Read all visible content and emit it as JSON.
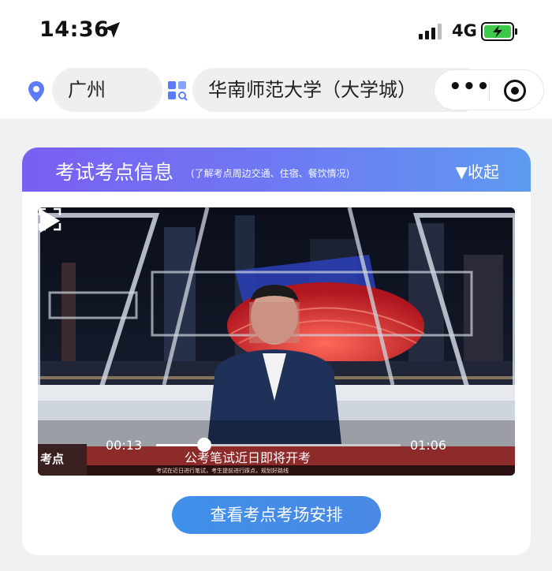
{
  "status_bar": {
    "time": "14:36",
    "network": "4G",
    "icons": [
      "location-arrow-icon",
      "signal-icon",
      "battery-charging-icon"
    ],
    "battery_color": "#3fc94a"
  },
  "nav": {
    "city": "广州",
    "campus": "华南师范大学（大学城）",
    "more_label": "•••",
    "icons": [
      "location-pin-icon",
      "campus-grid-icon",
      "close-target-icon"
    ],
    "pin_color": "#5b7cf6"
  },
  "card": {
    "title": "考试考点信息",
    "subtitle": "(了解考点周边交通、住宿、餐饮情况)",
    "collapse_label": "▼收起",
    "header_gradient": [
      "#7a5ff2",
      "#5e9af0"
    ],
    "video": {
      "current_time": "00:13",
      "duration": "01:06",
      "progress": 0.197,
      "news_tag": "考点",
      "ticker_title": "公考笔试近日即将开考",
      "ticker_subtitle": "考试在近日进行笔试，考生提前进行踩点，规划好路线",
      "icons": [
        "play-icon",
        "fullscreen-icon"
      ]
    },
    "action_button": "查看考点考场安排",
    "accent_color": "#418de9"
  }
}
